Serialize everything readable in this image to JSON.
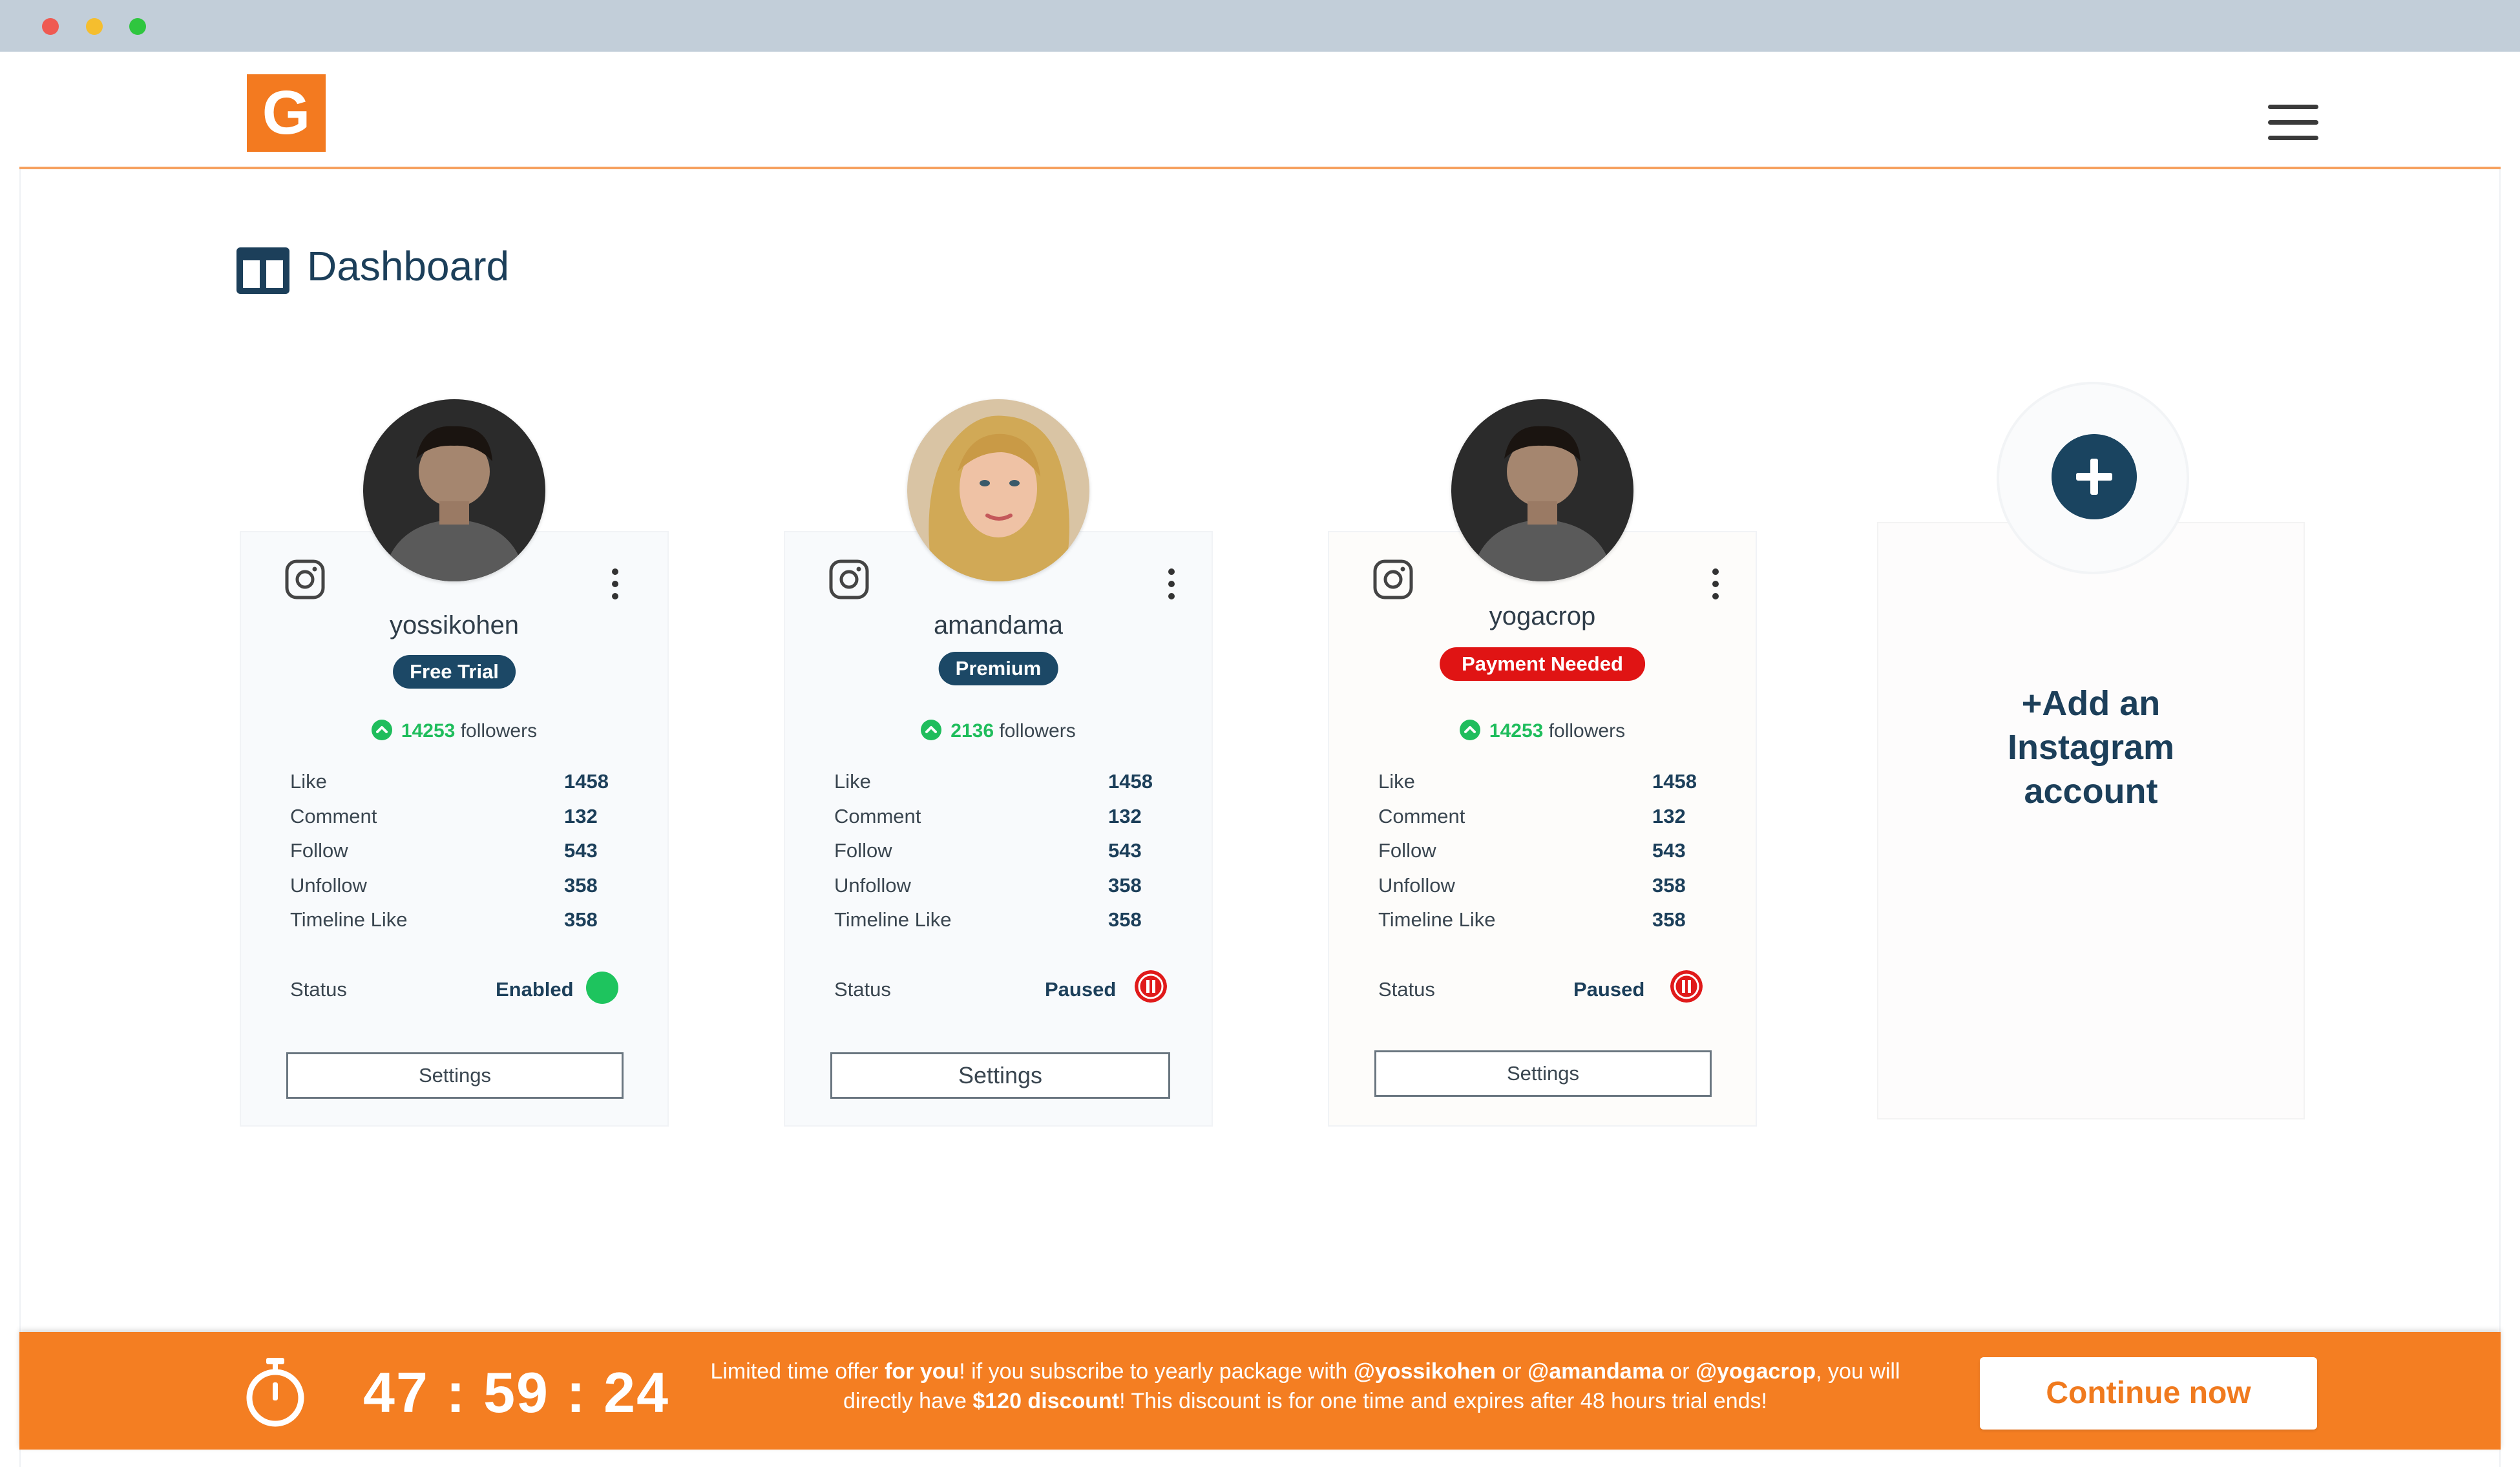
{
  "header": {
    "logo_letter": "G",
    "menu_icon": "hamburger-icon"
  },
  "page": {
    "title": "Dashboard",
    "title_icon": "dashboard-icon"
  },
  "accounts": [
    {
      "username": "yossikohen",
      "plan": "Free Trial",
      "plan_color": "#1c4866",
      "followers_count": "14253",
      "followers_label": "followers",
      "stats": [
        {
          "label": "Like",
          "value": "1458"
        },
        {
          "label": "Comment",
          "value": "132"
        },
        {
          "label": "Follow",
          "value": "543"
        },
        {
          "label": "Unfollow",
          "value": "358"
        },
        {
          "label": "Timeline Like",
          "value": "358"
        }
      ],
      "status_label": "Status",
      "status_value": "Enabled",
      "status_color": "#1ec45e",
      "settings_label": "Settings"
    },
    {
      "username": "amandama",
      "plan": "Premium",
      "plan_color": "#1c4866",
      "followers_count": "2136",
      "followers_label": "followers",
      "stats": [
        {
          "label": "Like",
          "value": "1458"
        },
        {
          "label": "Comment",
          "value": "132"
        },
        {
          "label": "Follow",
          "value": "543"
        },
        {
          "label": "Unfollow",
          "value": "358"
        },
        {
          "label": "Timeline Like",
          "value": "358"
        }
      ],
      "status_label": "Status",
      "status_value": "Paused",
      "status_color": "#e01a1a",
      "settings_label": "Settings"
    },
    {
      "username": "yogacrop",
      "plan": "Payment Needed",
      "plan_color": "#e01414",
      "followers_count": "14253",
      "followers_label": "followers",
      "stats": [
        {
          "label": "Like",
          "value": "1458"
        },
        {
          "label": "Comment",
          "value": "132"
        },
        {
          "label": "Follow",
          "value": "543"
        },
        {
          "label": "Unfollow",
          "value": "358"
        },
        {
          "label": "Timeline Like",
          "value": "358"
        }
      ],
      "status_label": "Status",
      "status_value": "Paused",
      "status_color": "#e01a1a",
      "settings_label": "Settings"
    }
  ],
  "add_account": {
    "line1": "+Add an",
    "line2": "Instagram",
    "line3": "account"
  },
  "promo": {
    "countdown": "47 : 59 : 24",
    "text_1": "Limited time offer ",
    "text_for_you": "for you",
    "text_2": "! if you subscribe to yearly package with ",
    "handle_1": "@yossikohen",
    "text_or_1": " or ",
    "handle_2": "@amandama",
    "text_or_2": " or ",
    "handle_3": "@yogacrop",
    "text_3": ", you will directly have ",
    "discount": "$120 discount",
    "text_4": "! This discount is for one time and expires after 48 hours trial ends!",
    "cta_label": "Continue now"
  },
  "colors": {
    "brand_orange": "#f47e22",
    "navy": "#1c3f5a",
    "enabled_green": "#1ec45e",
    "paused_red": "#e01a1a"
  }
}
